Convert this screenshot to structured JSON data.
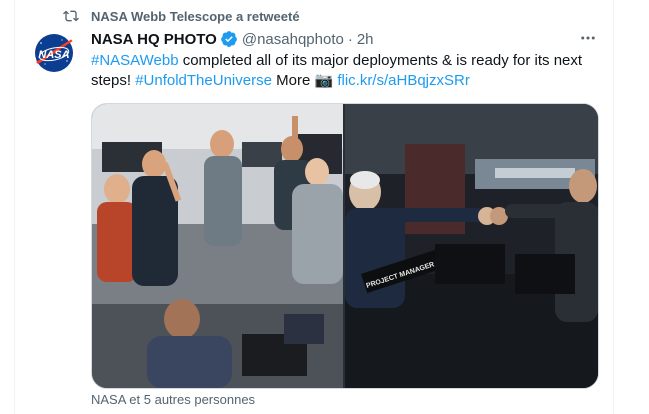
{
  "retweet": {
    "icon": "retweet-icon",
    "text": "NASA Webb Telescope a retweeté"
  },
  "author": {
    "display_name": "NASA HQ PHOTO",
    "handle": "@nasahqphoto",
    "separator": "·",
    "time": "2h",
    "verified_icon": "verified-badge-icon",
    "avatar": "nasa-logo-avatar"
  },
  "tweet": {
    "text_parts": {
      "hashtag1": "#NASAWebb",
      "body1": " completed all of its major deployments & is ready for its next steps! ",
      "hashtag2": "#UnfoldTheUniverse",
      "body2": " More ",
      "camera_icon": "📷",
      "link": "flic.kr/s/aHBqjzxSRr"
    }
  },
  "media": {
    "left_photo": "team-celebrating-photo",
    "right_photo": "fist-bump-control-room-photo",
    "sign_text": "PROJECT MANAGER"
  },
  "social_context": "NASA et 5 autres personnes",
  "colors": {
    "accent": "#1d9bf0",
    "secondary_text": "#536471",
    "primary_text": "#0f1419",
    "border": "#cfd9de"
  }
}
